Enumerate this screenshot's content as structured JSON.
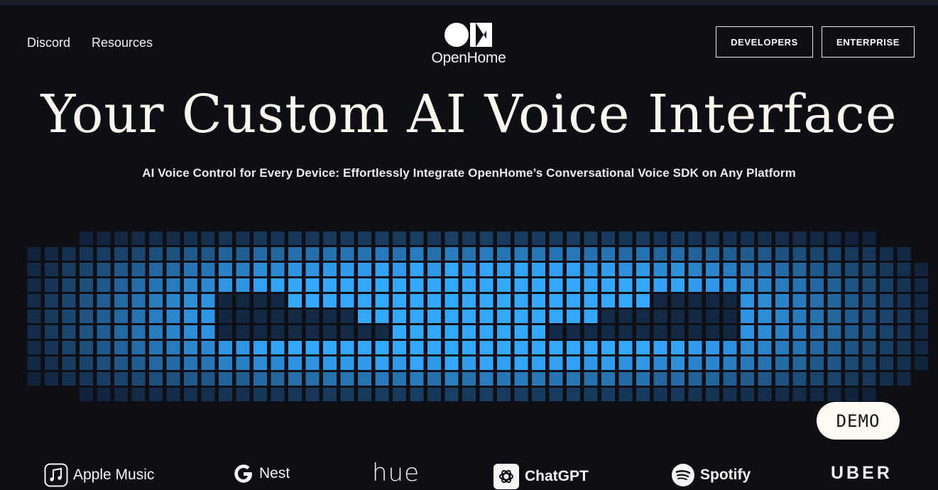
{
  "nav": {
    "links": [
      "Discord",
      "Resources"
    ],
    "logo_text": "OpenHome",
    "developers_label": "DEVELOPERS",
    "enterprise_label": "ENTERPRISE"
  },
  "hero": {
    "title": "Your Custom AI Voice Interface",
    "subtitle": "AI Voice Control for Every Device: Effortlessly Integrate OpenHome’s Conversational Voice SDK on Any Platform",
    "demo_label": "DEMO"
  },
  "partners": [
    {
      "name": "Apple Music",
      "icon": "apple-music-icon"
    },
    {
      "name": "Nest",
      "icon": "google-g-icon"
    },
    {
      "name": "hue",
      "icon": ""
    },
    {
      "name": "ChatGPT",
      "icon": "openai-icon"
    },
    {
      "name": "Spotify",
      "icon": "spotify-icon"
    },
    {
      "name": "UBER",
      "icon": ""
    }
  ],
  "colors": {
    "background": "#0e0f14",
    "accent_blue": "#33a8ff",
    "demo_button": "#fdfbf3"
  }
}
